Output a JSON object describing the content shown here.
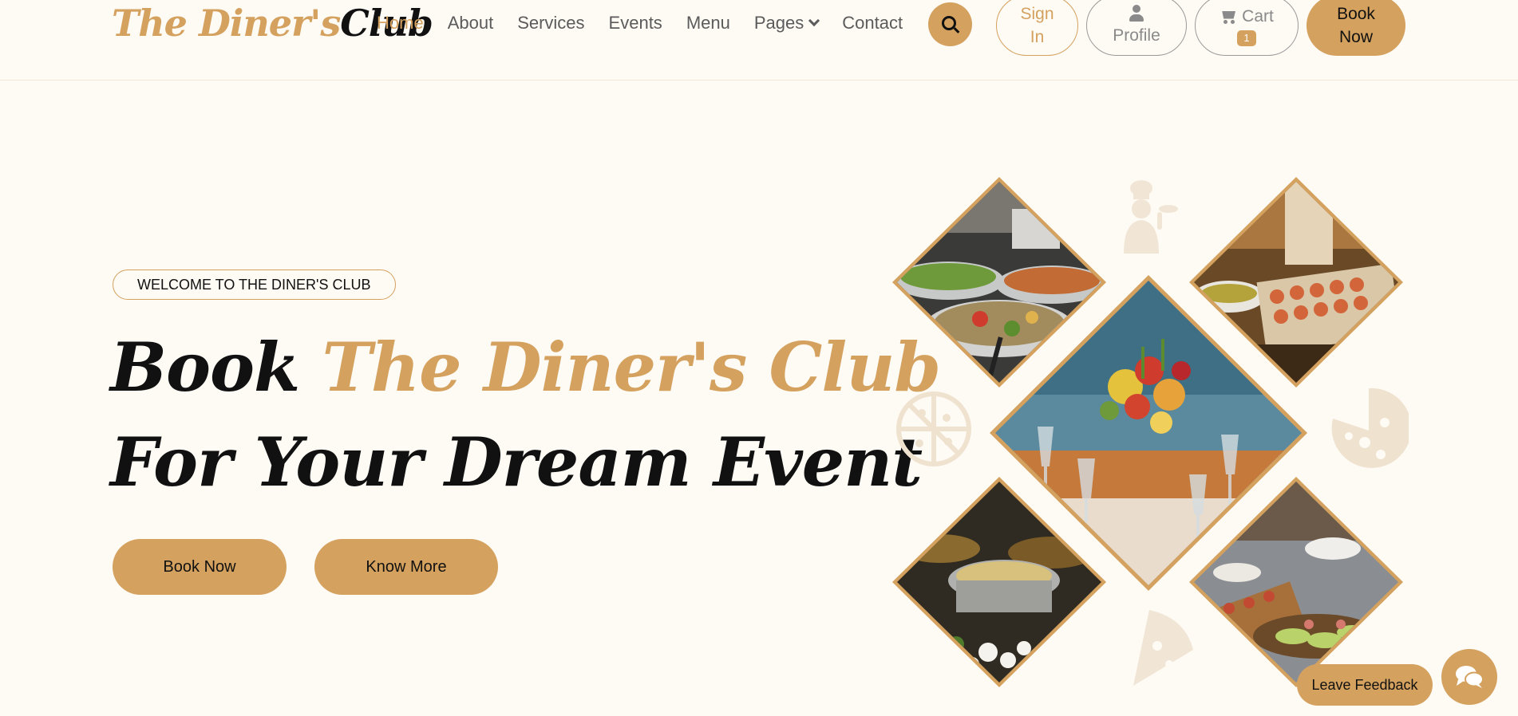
{
  "brand": {
    "part1": "The Diner's",
    "part2": "Club"
  },
  "nav": {
    "links": [
      "Home",
      "About",
      "Services",
      "Events",
      "Menu",
      "Pages",
      "Contact"
    ],
    "active": "Home"
  },
  "header_buttons": {
    "sign_in_line1": "Sign",
    "sign_in_line2": "In",
    "profile": "Profile",
    "cart": "Cart",
    "cart_count": "1",
    "book_line1": "Book",
    "book_line2": "Now"
  },
  "hero": {
    "welcome": "WELCOME TO THE DINER'S CLUB",
    "line1_dark": "Book",
    "line1_gold": "The Diner's Club",
    "line2": "For Your Dream Event",
    "book_button": "Book Now",
    "more_button": "Know More"
  },
  "gallery": {
    "images": [
      "salad-buffet-photo",
      "canape-platter-photo",
      "table-setting-flowers-photo",
      "hot-buffet-photo",
      "appetizer-board-photo"
    ]
  },
  "feedback": {
    "label": "Leave Feedback"
  },
  "colors": {
    "accent": "#d4a15e",
    "background": "#fefaf4",
    "text": "#111111",
    "muted": "#5b5b5b"
  }
}
